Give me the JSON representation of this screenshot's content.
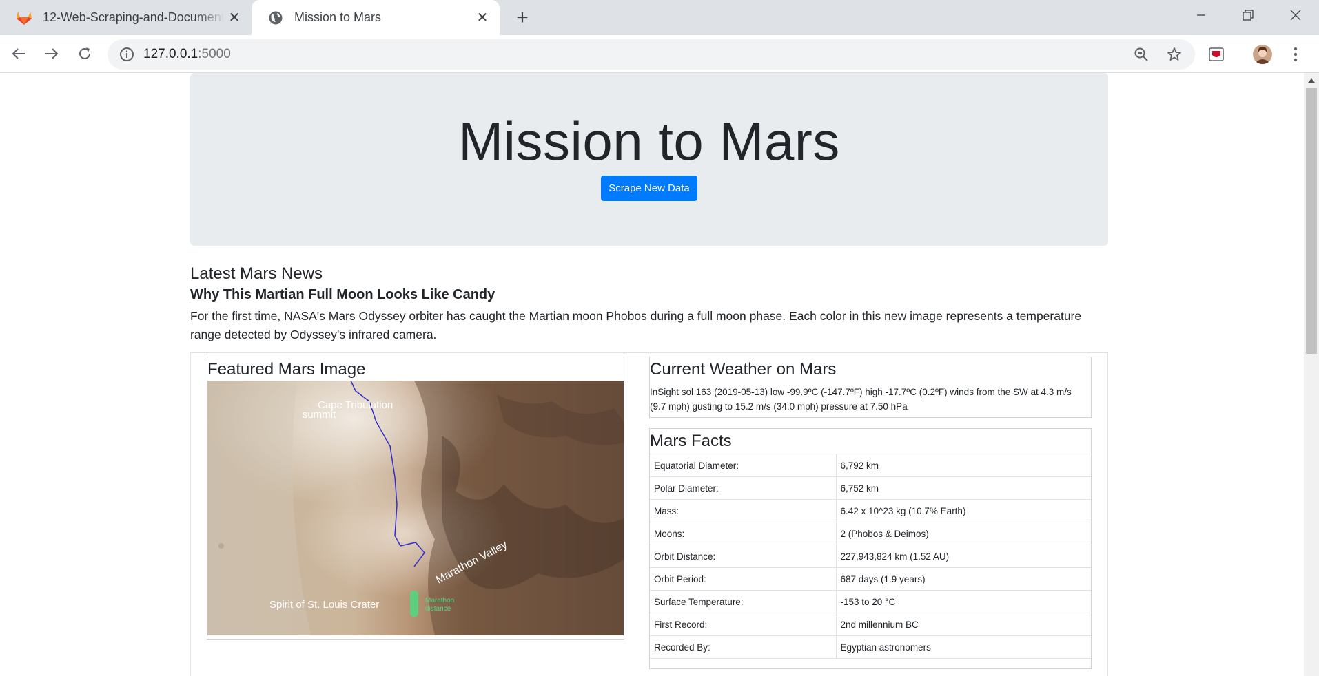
{
  "browser": {
    "tabs": [
      {
        "title": "12-Web-Scraping-and-Document",
        "favicon": "gitlab-icon",
        "active": false
      },
      {
        "title": "Mission to Mars",
        "favicon": "globe-icon",
        "active": true
      }
    ],
    "url_host": "127.0.0.1",
    "url_port": ":5000"
  },
  "jumbotron": {
    "title": "Mission to Mars",
    "button_label": "Scrape New Data",
    "button_color": "#007bff"
  },
  "news": {
    "heading": "Latest Mars News",
    "title": "Why This Martian Full Moon Looks Like Candy",
    "paragraph": "For the first time, NASA's Mars Odyssey orbiter has caught the Martian moon Phobos during a full moon phase. Each color in this new image represents a temperature range detected by Odyssey's infrared camera."
  },
  "featured_image": {
    "heading": "Featured Mars Image",
    "labels": {
      "cape": "Cape Tribulation",
      "summit": "summit",
      "valley": "Marathon Valley",
      "crater": "Spirit of St. Louis Crater",
      "marathon": "Marathon",
      "distance": "distance"
    }
  },
  "weather": {
    "heading": "Current Weather on Mars",
    "text": "InSight sol 163 (2019-05-13) low -99.9ºC (-147.7ºF) high -17.7ºC (0.2ºF) winds from the SW at 4.3 m/s (9.7 mph) gusting to 15.2 m/s (34.0 mph) pressure at 7.50 hPa"
  },
  "facts": {
    "heading": "Mars Facts",
    "rows": [
      {
        "label": "Equatorial Diameter:",
        "value": "6,792 km"
      },
      {
        "label": "Polar Diameter:",
        "value": "6,752 km"
      },
      {
        "label": "Mass:",
        "value": "6.42 x 10^23 kg (10.7% Earth)"
      },
      {
        "label": "Moons:",
        "value": "2 (Phobos & Deimos)"
      },
      {
        "label": "Orbit Distance:",
        "value": "227,943,824 km (1.52 AU)"
      },
      {
        "label": "Orbit Period:",
        "value": "687 days (1.9 years)"
      },
      {
        "label": "Surface Temperature:",
        "value": "-153 to 20 °C"
      },
      {
        "label": "First Record:",
        "value": "2nd millennium BC"
      },
      {
        "label": "Recorded By:",
        "value": "Egyptian astronomers"
      }
    ]
  }
}
